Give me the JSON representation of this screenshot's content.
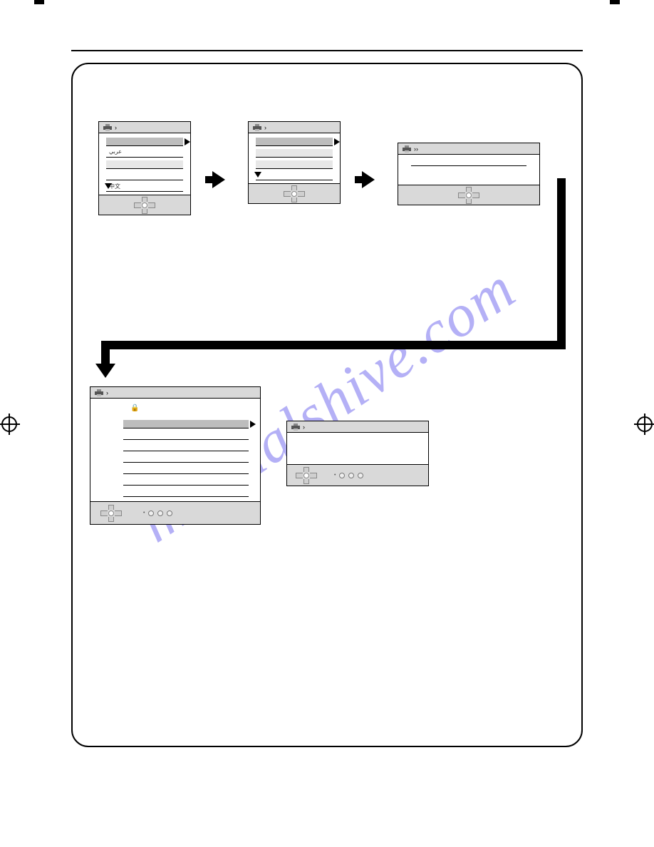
{
  "watermark": "manualshive.com",
  "osdA": {
    "titlebar_marker": "›",
    "items": [
      {
        "label": "",
        "selected": true
      },
      {
        "label": "عربي",
        "selected": false,
        "alt": false
      },
      {
        "label": "",
        "selected": false,
        "alt": true
      },
      {
        "label": "",
        "selected": false,
        "alt": false
      },
      {
        "label": "中文",
        "selected": false,
        "alt": false
      }
    ],
    "has_scroll_down": true
  },
  "osdB": {
    "titlebar_marker": "›",
    "items": [
      {
        "label": "",
        "selected": true
      },
      {
        "label": "",
        "selected": false,
        "alt": true
      },
      {
        "label": "",
        "selected": false,
        "alt": true
      },
      {
        "label": "",
        "selected": false,
        "alt": false
      }
    ],
    "has_scroll_down": true
  },
  "osdC": {
    "titlebar_marker": "››"
  },
  "osdD": {
    "titlebar_marker": "›",
    "lock_icon": "🔒",
    "items": [
      {
        "selected": true
      },
      {
        "selected": false
      },
      {
        "selected": false
      },
      {
        "selected": false
      },
      {
        "selected": false
      },
      {
        "selected": false
      },
      {
        "selected": false
      }
    ]
  },
  "osdE": {
    "titlebar_marker": "›"
  }
}
